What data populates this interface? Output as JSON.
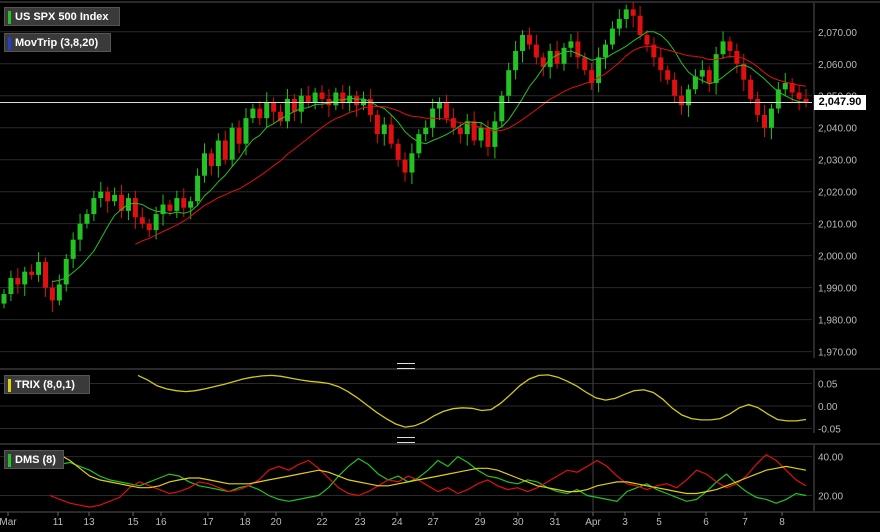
{
  "legends": {
    "main": {
      "label": "US SPX 500 Index",
      "color": "#22c322"
    },
    "movtrip": {
      "label": "MovTrip (3,8,20)",
      "color": "#2040d0"
    },
    "trix": {
      "label": "TRIX (8,0,1)",
      "color": "#e0d010"
    },
    "dms": {
      "label": "DMS (8)",
      "color": "#22c322"
    }
  },
  "price_badge": "2,047.90",
  "colors": {
    "up": "#22c322",
    "down": "#e01010",
    "fast": "#22c322",
    "slow": "#e01010",
    "trix": "#d4c818",
    "dms_plus": "#22c322",
    "dms_minus": "#e01010",
    "adx": "#e0d010",
    "grid": "#2a2a2a",
    "axis_text": "#bbbbbb"
  },
  "chart_data": [
    {
      "type": "candlestick",
      "title": "US SPX 500 Index",
      "ylim": [
        1968,
        2079
      ],
      "yticks": [
        "1,970.00",
        "1,980.00",
        "1,990.00",
        "2,000.00",
        "2,010.00",
        "2,020.00",
        "2,030.00",
        "2,040.00",
        "2,050.00",
        "2,060.00",
        "2,070.00"
      ],
      "ytick_values": [
        1970,
        1980,
        1990,
        2000,
        2010,
        2020,
        2030,
        2040,
        2050,
        2060,
        2070
      ],
      "last_price": 2047.9,
      "x_labels": [
        "Mar",
        "11",
        "13",
        "15",
        "16",
        "17",
        "18",
        "20",
        "22",
        "23",
        "24",
        "27",
        "29",
        "30",
        "31",
        "Apr",
        "3",
        "5",
        "6",
        "7",
        "8"
      ],
      "closes": [
        1988,
        1993,
        1991,
        1995,
        1994,
        1998,
        1990,
        1986,
        1991,
        1999,
        2005,
        2010,
        2013,
        2018,
        2020,
        2017,
        2019,
        2014,
        2018,
        2012,
        2010,
        2008,
        2013,
        2016,
        2014,
        2018,
        2015,
        2017,
        2025,
        2032,
        2028,
        2036,
        2030,
        2040,
        2035,
        2043,
        2046,
        2043,
        2048,
        2045,
        2042,
        2049,
        2045,
        2050,
        2048,
        2051,
        2049,
        2047,
        2051,
        2048,
        2050,
        2047,
        2049,
        2044,
        2038,
        2041,
        2035,
        2030,
        2026,
        2032,
        2038,
        2040,
        2046,
        2048,
        2043,
        2040,
        2038,
        2042,
        2036,
        2040,
        2034,
        2042,
        2050,
        2058,
        2064,
        2069,
        2066,
        2062,
        2059,
        2064,
        2060,
        2065,
        2067,
        2062,
        2058,
        2054,
        2062,
        2066,
        2071,
        2074,
        2077,
        2075,
        2069,
        2066,
        2062,
        2058,
        2055,
        2050,
        2047,
        2052,
        2056,
        2058,
        2054,
        2063,
        2067,
        2064,
        2060,
        2055,
        2049,
        2044,
        2040,
        2046,
        2052,
        2054,
        2051,
        2049,
        2047.9
      ]
    },
    {
      "type": "line",
      "title": "TRIX (8,0,1)",
      "ylim": [
        -0.06,
        0.08
      ],
      "yticks": [
        "0.05",
        "0.00",
        "-0.05"
      ],
      "ytick_values": [
        0.05,
        0.0,
        -0.05
      ],
      "values": [
        0.068,
        0.058,
        0.045,
        0.038,
        0.034,
        0.032,
        0.034,
        0.038,
        0.043,
        0.048,
        0.054,
        0.06,
        0.064,
        0.067,
        0.068,
        0.066,
        0.062,
        0.058,
        0.055,
        0.053,
        0.05,
        0.043,
        0.032,
        0.018,
        0.002,
        -0.014,
        -0.028,
        -0.04,
        -0.047,
        -0.044,
        -0.035,
        -0.022,
        -0.012,
        -0.006,
        -0.004,
        -0.005,
        -0.01,
        -0.008,
        0.006,
        0.025,
        0.045,
        0.06,
        0.068,
        0.069,
        0.064,
        0.055,
        0.044,
        0.03,
        0.018,
        0.013,
        0.017,
        0.026,
        0.034,
        0.036,
        0.03,
        0.015,
        -0.005,
        -0.02,
        -0.028,
        -0.031,
        -0.031,
        -0.028,
        -0.018,
        -0.004,
        0.003,
        -0.004,
        -0.018,
        -0.03,
        -0.033,
        -0.033,
        -0.03
      ]
    },
    {
      "type": "line",
      "title": "DMS (8)",
      "ylim": [
        12,
        46
      ],
      "yticks": [
        "40.00",
        "20.00"
      ],
      "ytick_values": [
        40,
        20
      ],
      "series": [
        {
          "values": [
            38,
            36,
            37,
            35,
            33,
            30,
            28,
            27,
            26,
            25,
            27,
            29,
            31,
            30,
            27,
            25,
            24,
            23,
            22,
            24,
            25,
            23,
            20,
            18,
            17,
            18,
            19,
            20,
            24,
            30,
            35,
            39,
            36,
            31,
            28,
            30,
            27,
            29,
            33,
            38,
            35,
            40,
            37,
            33,
            30,
            29,
            27,
            26,
            28,
            27,
            24,
            22,
            21,
            23,
            20,
            19,
            18,
            17,
            22,
            24,
            26,
            23,
            21,
            19,
            17,
            18,
            22,
            27,
            31,
            26,
            22,
            19,
            18,
            16,
            18,
            21,
            20
          ]
        },
        {
          "values": [
            20,
            18,
            16,
            15,
            14,
            15,
            17,
            19,
            24,
            27,
            25,
            23,
            21,
            22,
            24,
            27,
            26,
            24,
            22,
            23,
            25,
            28,
            33,
            35,
            33,
            36,
            38,
            34,
            29,
            24,
            21,
            20,
            22,
            25,
            28,
            27,
            30,
            28,
            25,
            22,
            24,
            21,
            23,
            26,
            28,
            25,
            23,
            24,
            22,
            24,
            27,
            30,
            33,
            32,
            35,
            38,
            35,
            30,
            26,
            25,
            23,
            25,
            26,
            24,
            28,
            33,
            31,
            27,
            24,
            26,
            30,
            36,
            41,
            38,
            33,
            28,
            25
          ]
        },
        {
          "values": [
            42,
            41,
            38,
            34,
            30,
            28,
            27,
            26,
            25,
            24,
            24,
            25,
            27,
            28,
            29,
            29,
            28,
            27,
            26,
            26,
            26,
            27,
            28,
            29,
            30,
            31,
            32,
            33,
            32,
            30,
            28,
            27,
            26,
            25,
            25,
            26,
            27,
            28,
            29,
            30,
            31,
            32,
            33,
            34,
            34,
            33,
            31,
            29,
            27,
            25,
            24,
            23,
            22,
            22,
            23,
            25,
            26,
            27,
            27,
            26,
            25,
            24,
            23,
            22,
            21,
            21,
            22,
            23,
            25,
            27,
            29,
            31,
            33,
            34,
            35,
            34,
            33
          ]
        }
      ]
    }
  ]
}
